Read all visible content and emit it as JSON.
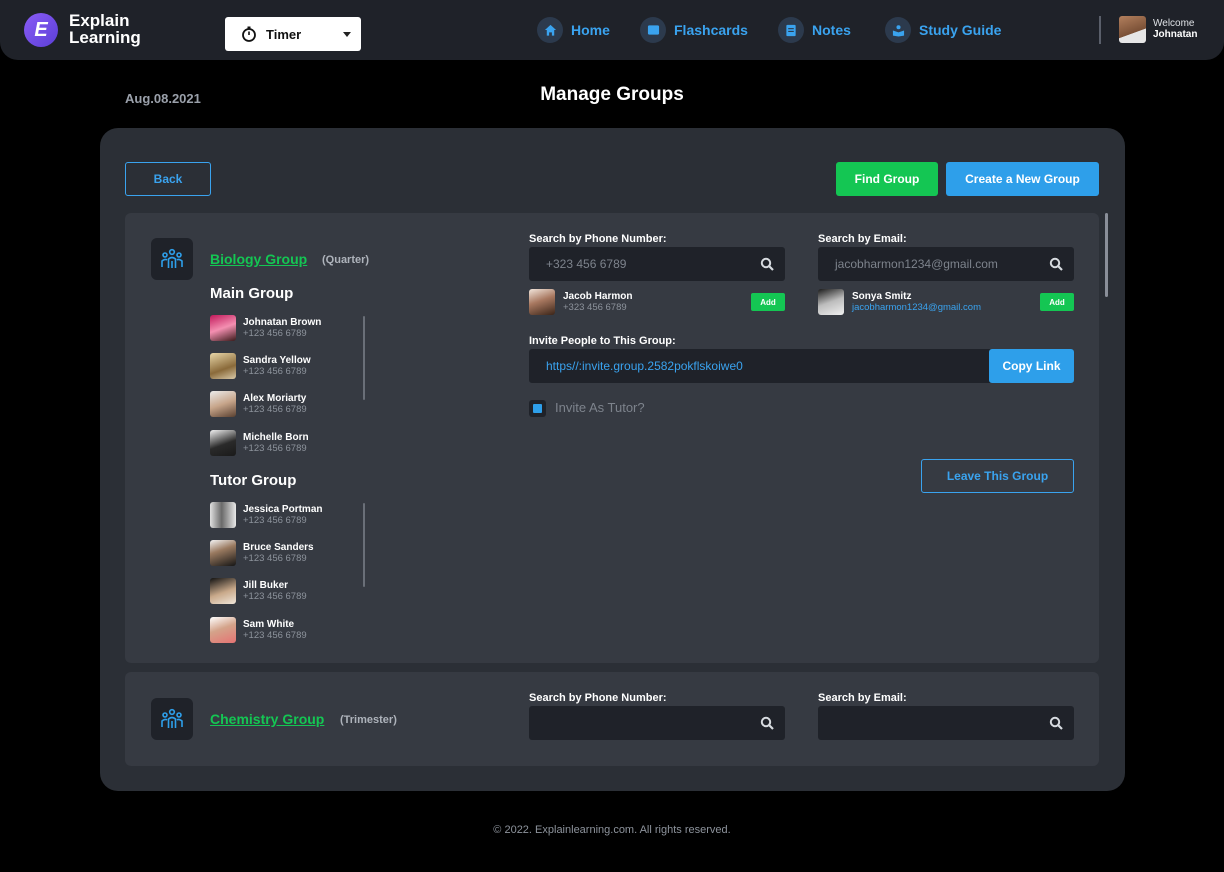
{
  "header": {
    "logo_letter": "E",
    "logo_line1": "Explain",
    "logo_line2": "Learning",
    "timer_label": "Timer",
    "nav": [
      {
        "label": "Home",
        "icon": "home-icon"
      },
      {
        "label": "Flashcards",
        "icon": "flashcards-icon"
      },
      {
        "label": "Notes",
        "icon": "notes-icon"
      },
      {
        "label": "Study Guide",
        "icon": "study-guide-icon"
      }
    ],
    "welcome": "Welcome",
    "user_name": "Johnatan"
  },
  "page": {
    "date": "Aug.08.2021",
    "title": "Manage Groups"
  },
  "actions": {
    "back": "Back",
    "find_group": "Find Group",
    "create_group": "Create a New Group"
  },
  "groups": [
    {
      "name": "Biology Group",
      "term": "(Quarter)",
      "main_heading": "Main Group",
      "main_members": [
        {
          "name": "Johnatan Brown",
          "phone": "+123 456 6789"
        },
        {
          "name": "Sandra Yellow",
          "phone": "+123 456 6789"
        },
        {
          "name": "Alex Moriarty",
          "phone": "+123 456 6789"
        },
        {
          "name": "Michelle Born",
          "phone": "+123 456 6789"
        }
      ],
      "tutor_heading": "Tutor Group",
      "tutor_members": [
        {
          "name": "Jessica Portman",
          "phone": "+123 456 6789"
        },
        {
          "name": "Bruce Sanders",
          "phone": "+123 456 6789"
        },
        {
          "name": "Jill Buker",
          "phone": "+123 456 6789"
        },
        {
          "name": "Sam White",
          "phone": "+123 456 6789"
        }
      ],
      "phone_search_label": "Search by Phone Number:",
      "phone_search_placeholder": "+323 456 6789",
      "email_search_label": "Search by Email:",
      "email_search_placeholder": "jacobharmon1234@gmail.com",
      "phone_result": {
        "name": "Jacob Harmon",
        "phone": "+323 456 6789",
        "add": "Add"
      },
      "email_result": {
        "name": "Sonya Smitz",
        "email": "jacobharmon1234@gmail.com",
        "add": "Add"
      },
      "invite_label": "Invite People to This Group:",
      "invite_link": "https//:invite.group.2582pokflskoiwe0",
      "copy_link": "Copy Link",
      "invite_as_tutor": "Invite As Tutor?",
      "invite_as_tutor_checked": true,
      "leave": "Leave This Group"
    },
    {
      "name": "Chemistry Group",
      "term": "(Trimester)",
      "phone_search_label": "Search by Phone Number:",
      "email_search_label": "Search by Email:"
    }
  ],
  "footer": "© 2022. Explainlearning.com. All rights reserved.",
  "colors": {
    "accent_blue": "#2e9fea",
    "accent_green": "#14c653",
    "panel": "#2b2f36",
    "card": "#363a42"
  }
}
